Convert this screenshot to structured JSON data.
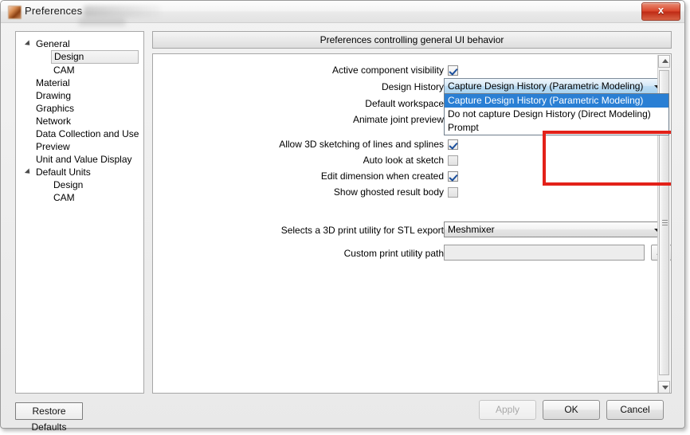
{
  "window": {
    "title": "Preferences",
    "app_icon": "app-icon",
    "close_label": "x"
  },
  "sidebar": {
    "items": [
      {
        "label": "General",
        "level": 0,
        "expander": true,
        "selected": false
      },
      {
        "label": "Design",
        "level": 1,
        "expander": false,
        "selected": true
      },
      {
        "label": "CAM",
        "level": 1,
        "expander": false,
        "selected": false
      },
      {
        "label": "Material",
        "level": 0,
        "expander": false,
        "selected": false
      },
      {
        "label": "Drawing",
        "level": 0,
        "expander": false,
        "selected": false
      },
      {
        "label": "Graphics",
        "level": 0,
        "expander": false,
        "selected": false
      },
      {
        "label": "Network",
        "level": 0,
        "expander": false,
        "selected": false
      },
      {
        "label": "Data Collection and Use",
        "level": 0,
        "expander": false,
        "selected": false
      },
      {
        "label": "Preview",
        "level": 0,
        "expander": false,
        "selected": false
      },
      {
        "label": "Unit and Value Display",
        "level": 0,
        "expander": false,
        "selected": false
      },
      {
        "label": "Default Units",
        "level": 0,
        "expander": true,
        "selected": false
      },
      {
        "label": "Design",
        "level": 1,
        "expander": false,
        "selected": false
      },
      {
        "label": "CAM",
        "level": 1,
        "expander": false,
        "selected": false
      }
    ]
  },
  "panel": {
    "header": "Preferences controlling general UI behavior",
    "rows": {
      "active_component_visibility": {
        "label": "Active component visibility",
        "checked": true
      },
      "design_history": {
        "label": "Design History"
      },
      "default_workspace": {
        "label": "Default workspace"
      },
      "animate_joint_preview": {
        "label": "Animate joint preview"
      },
      "allow_3d_sketching": {
        "label": "Allow 3D sketching of lines and splines",
        "checked": true
      },
      "auto_look_at_sketch": {
        "label": "Auto look at sketch",
        "checked": false
      },
      "edit_dimension_when_created": {
        "label": "Edit dimension when created",
        "checked": true
      },
      "show_ghosted_result_body": {
        "label": "Show ghosted result body",
        "checked": false
      },
      "stl_utility": {
        "label": "Selects a 3D print utility for STL export",
        "value": "Meshmixer"
      },
      "custom_print_path": {
        "label": "Custom print utility path",
        "value": "",
        "browse_label": "..."
      }
    },
    "design_history_dropdown": {
      "selected": "Capture Design History (Parametric Modeling)",
      "open": true,
      "options": [
        "Capture Design History (Parametric Modeling)",
        "Do not capture Design History (Direct Modeling)",
        "Prompt"
      ]
    },
    "highlight_color": "#e32119"
  },
  "footer": {
    "restore_defaults": "Restore Defaults",
    "apply": "Apply",
    "apply_enabled": false,
    "ok": "OK",
    "cancel": "Cancel"
  }
}
